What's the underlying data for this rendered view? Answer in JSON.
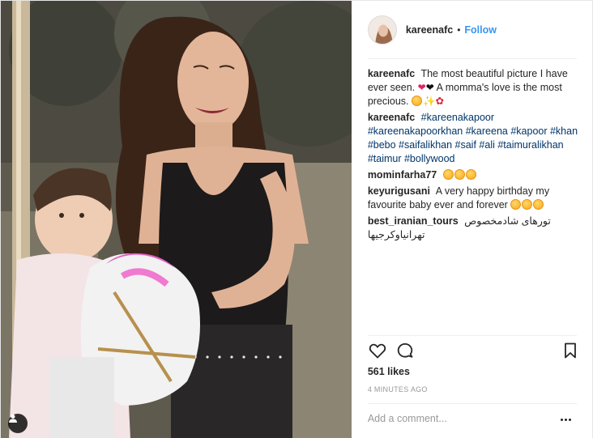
{
  "header": {
    "username": "kareenafc",
    "separator": "•",
    "follow_label": "Follow"
  },
  "comments": [
    {
      "user": "kareenafc",
      "text": "The most beautiful picture I have ever seen.",
      "text2": "A momma's love is the most precious."
    },
    {
      "user": "kareenafc",
      "tags": "#kareenakapoor #kareenakapoorkhan #kareena #kapoor #khan #bebo #saifalikhan #saif #ali #taimuralikhan #taimur #bollywood"
    },
    {
      "user": "mominfarha77"
    },
    {
      "user": "keyurigusani",
      "text": "A very happy birthday my favourite baby ever and forever"
    },
    {
      "user": "best_iranian_tours",
      "text": "تورهای شادمخصوص تهرانیاوکرجیها"
    }
  ],
  "icons": {
    "like": "heart-outline-icon",
    "comment": "comment-bubble-icon",
    "save": "bookmark-icon",
    "tag": "user-tag-icon",
    "more": "more-options-icon"
  },
  "likes_text": "561 likes",
  "time_text": "4 MINUTES AGO",
  "add_comment": {
    "placeholder": "Add a comment..."
  },
  "colors": {
    "follow": "#3897f0",
    "text": "#262626",
    "muted": "#999999",
    "border": "#efefef"
  }
}
